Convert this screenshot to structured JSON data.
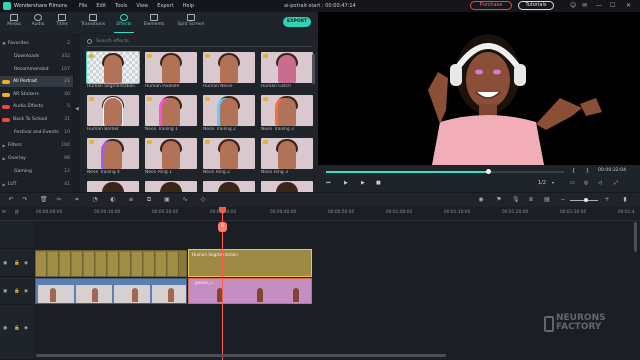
{
  "titlebar": {
    "app_name": "Wondershare Filmora",
    "menu": [
      "File",
      "Edit",
      "Tools",
      "View",
      "Export",
      "Help"
    ],
    "document": "ai-potrait-start : 00:00:47:14",
    "purchase": "Purchase",
    "tutorials": "Tutorials"
  },
  "toolbar": {
    "tabs": [
      "Media",
      "Audio",
      "Titles",
      "Transitions",
      "Effects",
      "Elements",
      "Split Screen"
    ],
    "active_tab": "Effects",
    "export_label": "EXPORT"
  },
  "sidebar": {
    "items": [
      {
        "label": "Favorites",
        "count": "2"
      },
      {
        "label": "Downloads",
        "count": "332"
      },
      {
        "label": "Recommended",
        "count": "107"
      },
      {
        "label": "All Portrait",
        "count": "21"
      },
      {
        "label": "AR Stickers",
        "count": "40"
      },
      {
        "label": "Audio Effects",
        "count": "5"
      },
      {
        "label": "Back To School",
        "count": "31"
      },
      {
        "label": "Festival and Events",
        "count": "10"
      },
      {
        "label": "Filters",
        "count": "160"
      },
      {
        "label": "Overlay",
        "count": "96"
      },
      {
        "label": "Gaming",
        "count": "12"
      },
      {
        "label": "LUT",
        "count": "41"
      }
    ]
  },
  "effects": {
    "search_placeholder": "Search effects",
    "tiles": [
      "Human Segmentation",
      "Human Pixelate",
      "Human Noise",
      "Human Glitch",
      "Human Border",
      "Neon Trailing 1",
      "Neon Trailing 2",
      "Neon Trailing 3",
      "Neon Trailing 4",
      "Neon Ring 1",
      "Neon Ring 2",
      "Neon Ring 3"
    ]
  },
  "player": {
    "timecode": "00:00:32:04",
    "ratio": "1/2",
    "progress": 0.68
  },
  "timeline": {
    "ruler": [
      "00:00:00:00",
      "00:00:10:00",
      "00:00:20:00",
      "00:00:30:00",
      "00:00:40:00",
      "00:00:50:00",
      "00:01:00:00",
      "00:01:10:00",
      "00:01:20:00",
      "00:01:30:00",
      "00:01:4"
    ],
    "clip_effect_label": "Human Segmentation",
    "clip_pink_label": "pexels_c...",
    "playhead_marker": "6"
  },
  "watermark": {
    "line1": "NEURONS",
    "line2": "FACTORY"
  },
  "colors": {
    "accent": "#38e0c4",
    "playhead": "#ff5a4d",
    "purchase": "#e64a3d"
  }
}
